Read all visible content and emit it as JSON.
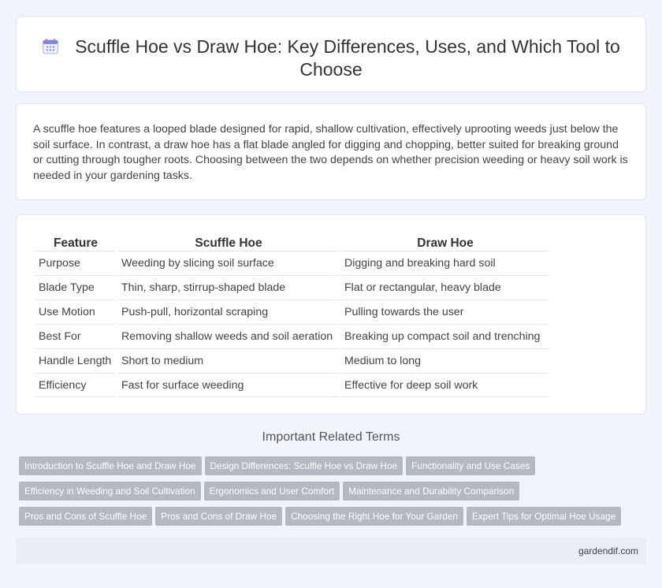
{
  "header": {
    "title": "Scuffle Hoe vs Draw Hoe: Key Differences, Uses, and Which Tool to Choose",
    "icon": "calendar-icon"
  },
  "intro": {
    "text": "A scuffle hoe features a looped blade designed for rapid, shallow cultivation, effectively uprooting weeds just below the soil surface. In contrast, a draw hoe has a flat blade angled for digging and chopping, better suited for breaking ground or cutting through tougher roots. Choosing between the two depends on whether precision weeding or heavy soil work is needed in your gardening tasks."
  },
  "table": {
    "headers": [
      "Feature",
      "Scuffle Hoe",
      "Draw Hoe"
    ],
    "rows": [
      [
        "Purpose",
        "Weeding by slicing soil surface",
        "Digging and breaking hard soil"
      ],
      [
        "Blade Type",
        "Thin, sharp, stirrup-shaped blade",
        "Flat or rectangular, heavy blade"
      ],
      [
        "Use Motion",
        "Push-pull, horizontal scraping",
        "Pulling towards the user"
      ],
      [
        "Best For",
        "Removing shallow weeds and soil aeration",
        "Breaking up compact soil and trenching"
      ],
      [
        "Handle Length",
        "Short to medium",
        "Medium to long"
      ],
      [
        "Efficiency",
        "Fast for surface weeding",
        "Effective for deep soil work"
      ]
    ]
  },
  "related": {
    "title": "Important Related Terms",
    "rows": [
      [
        "Introduction to Scuffle Hoe and Draw Hoe",
        "Design Differences: Scuffle Hoe vs Draw Hoe",
        "Functionality and Use Cases"
      ],
      [
        "Efficiency in Weeding and Soil Cultivation",
        "Ergonomics and User Comfort",
        "Maintenance and Durability Comparison"
      ],
      [
        "Pros and Cons of Scuffle Hoe",
        "Pros and Cons of Draw Hoe",
        "Choosing the Right Hoe for Your Garden",
        "Expert Tips for Optimal Hoe Usage"
      ]
    ]
  },
  "footer": {
    "site": "gardendif.com"
  },
  "colors": {
    "background": "#f1f4fa",
    "tag_background": "#b3b9c3",
    "footer_background": "#e8edf6",
    "icon_accent": "#6f7fe0"
  }
}
